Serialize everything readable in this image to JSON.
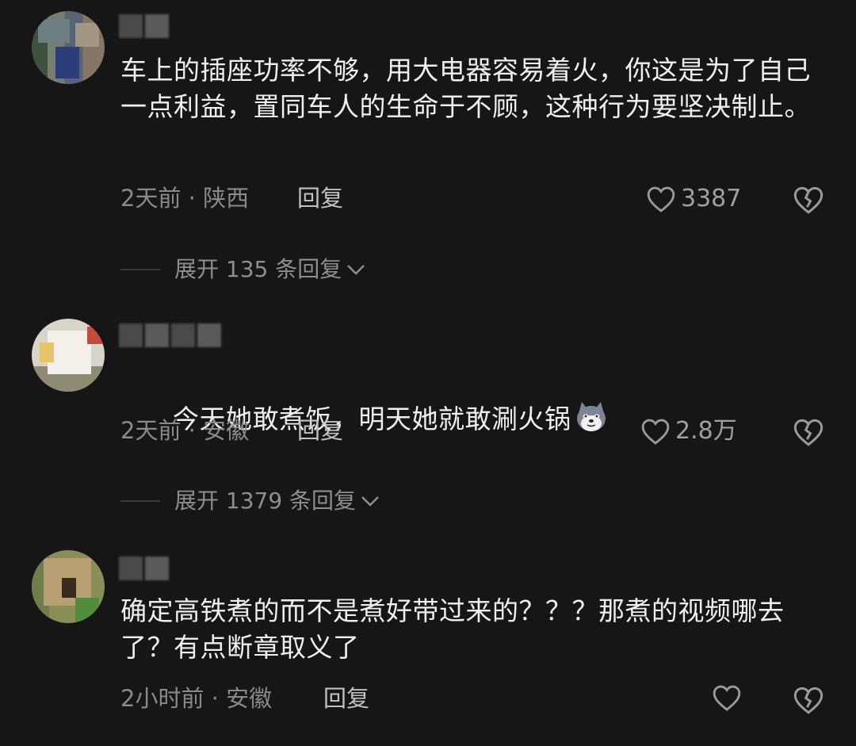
{
  "comments": [
    {
      "text": "车上的插座功率不够，用大电器容易着火，你这是为了自己一点利益，置同车人的生命于不顾，这种行为要坚决制止。",
      "meta": "2天前 · 陕西",
      "reply_label": "回复",
      "likes": "3387",
      "expand_label": "展开 135 条回复"
    },
    {
      "text": "今天她敢煮饭，明天她就敢涮火锅",
      "meta": "2天前 · 安徽",
      "reply_label": "回复",
      "likes": "2.8万",
      "expand_label": "展开 1379 条回复",
      "emoji": "husky-face-emoji"
    },
    {
      "text": "确定高铁煮的而不是煮好带过来的？？？那煮的视频哪去了？有点断章取义了",
      "meta": "2小时前 · 安徽",
      "reply_label": "回复",
      "likes": ""
    }
  ],
  "icons": {
    "like": "heart-outline-icon",
    "dislike": "broken-heart-icon",
    "expand": "chevron-down-icon"
  },
  "colors": {
    "background": "#161616",
    "text": "#efefef",
    "meta": "#8a8a8a"
  }
}
